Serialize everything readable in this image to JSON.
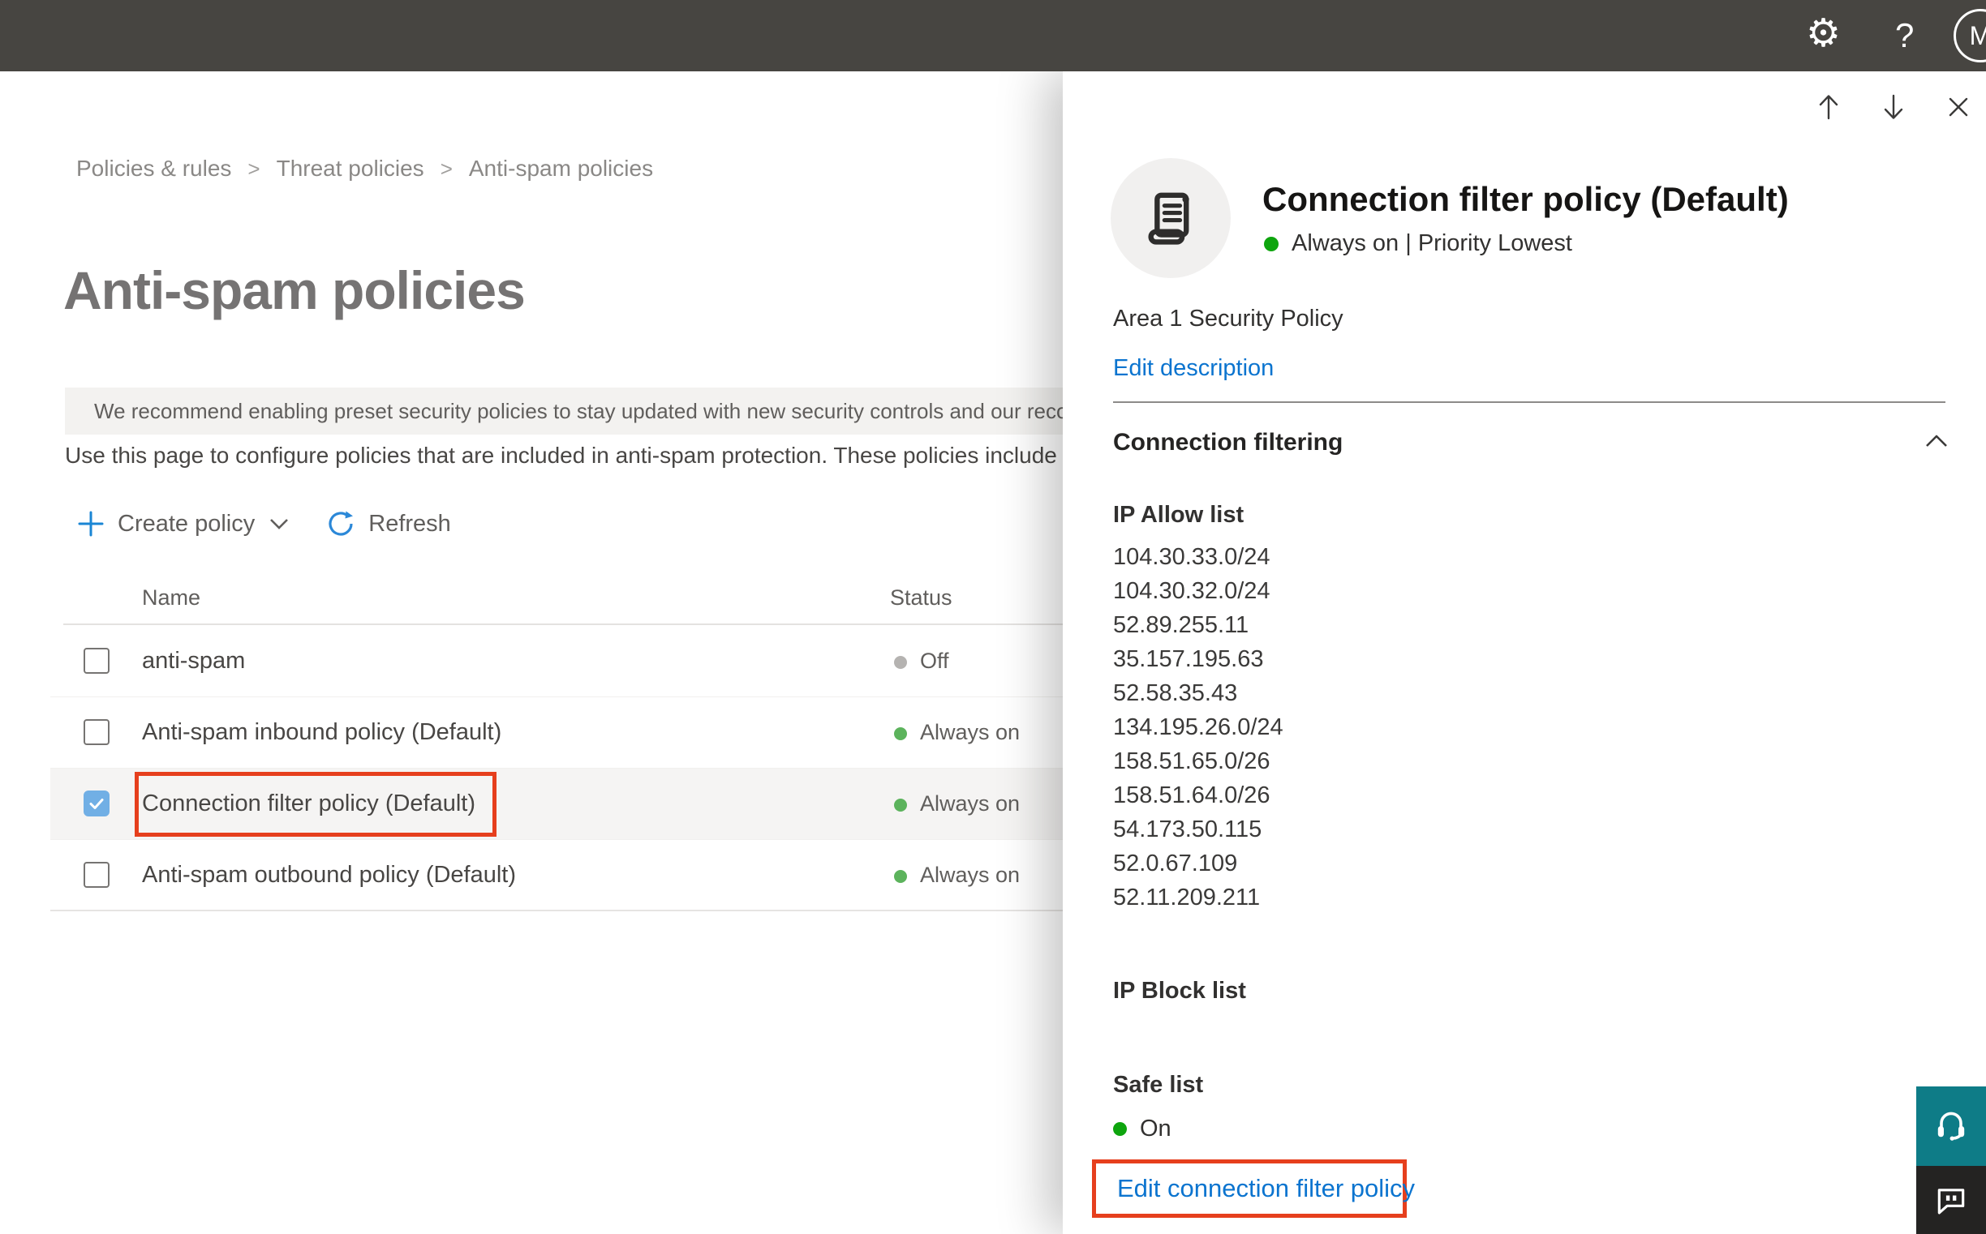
{
  "topbar": {
    "help_glyph": "?",
    "avatar_initial": "M",
    "icons": [
      "gear-icon",
      "help-icon",
      "avatar"
    ]
  },
  "breadcrumb": {
    "separator": ">",
    "items": [
      "Policies & rules",
      "Threat policies",
      "Anti-spam policies"
    ]
  },
  "page": {
    "title": "Anti-spam policies",
    "banner_text": "We recommend enabling preset security policies to stay updated with new security controls and our recomme",
    "description": "Use this page to configure policies that are included in anti-spam protection. These policies include"
  },
  "toolbar": {
    "create_policy_label": "Create policy",
    "refresh_label": "Refresh"
  },
  "table": {
    "columns": [
      "Name",
      "Status"
    ],
    "rows": [
      {
        "name": "anti-spam",
        "status": "Off",
        "status_color": "#b5b3b1",
        "checked": false,
        "selected": false,
        "outlined": false
      },
      {
        "name": "Anti-spam inbound policy (Default)",
        "status": "Always on",
        "status_color": "#5cb35c",
        "checked": false,
        "selected": false,
        "outlined": false
      },
      {
        "name": "Connection filter policy (Default)",
        "status": "Always on",
        "status_color": "#5cb35c",
        "checked": true,
        "selected": true,
        "outlined": true
      },
      {
        "name": "Anti-spam outbound policy (Default)",
        "status": "Always on",
        "status_color": "#5cb35c",
        "checked": false,
        "selected": false,
        "outlined": false
      }
    ]
  },
  "flyout": {
    "title": "Connection filter policy (Default)",
    "status_line": "Always on | Priority Lowest",
    "description": "Area 1 Security Policy",
    "edit_description_label": "Edit description",
    "section_title": "Connection filtering",
    "ip_allow": {
      "title": "IP Allow list",
      "items": [
        "104.30.33.0/24",
        "104.30.32.0/24",
        "52.89.255.11",
        "35.157.195.63",
        "52.58.35.43",
        "134.195.26.0/24",
        "158.51.65.0/26",
        "158.51.64.0/26",
        "54.173.50.115",
        "52.0.67.109",
        "52.11.209.211"
      ]
    },
    "ip_block": {
      "title": "IP Block list"
    },
    "safe_list": {
      "title": "Safe list",
      "status": "On"
    },
    "edit_link_label": "Edit connection filter policy"
  },
  "colors": {
    "topbar_bg": "#474541",
    "accent_blue": "#0b74cf",
    "checkbox_blue": "#71afe5",
    "highlight_red": "#e63f1d",
    "status_green_table": "#5cb35c",
    "status_green_vivid": "#0ea50e",
    "status_gray": "#b5b3b1",
    "support_teal": "#0e7c87",
    "support_dark": "#242322"
  }
}
